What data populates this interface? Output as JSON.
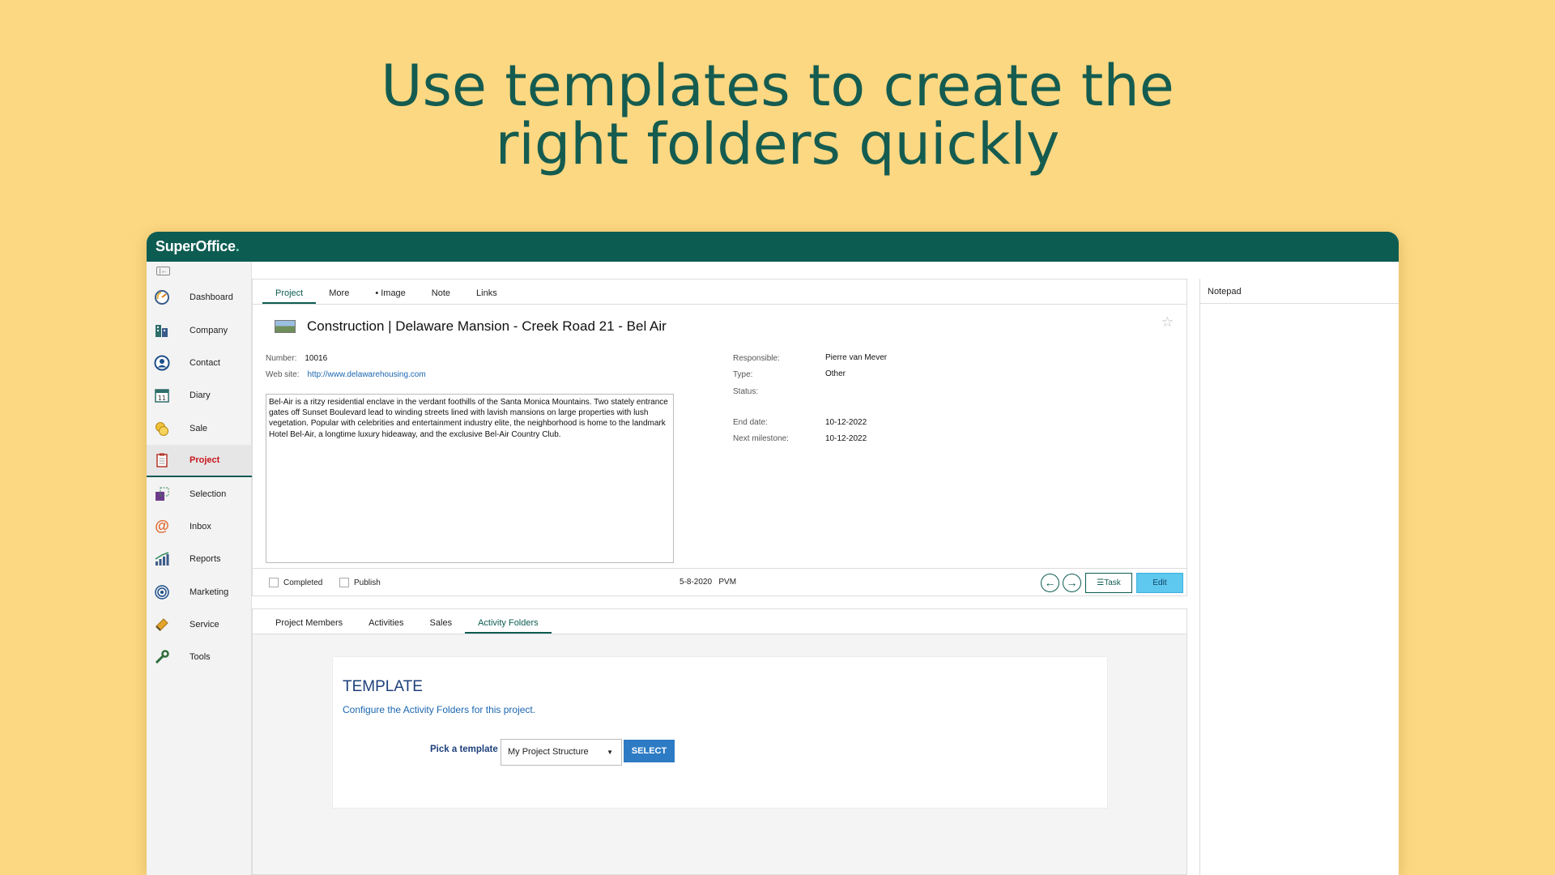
{
  "headline": {
    "line1": "Use templates to create the",
    "line2": "right folders quickly"
  },
  "app": {
    "logo": "SuperOffice",
    "logo_dot": "."
  },
  "sidebar": {
    "items": [
      {
        "label": "Dashboard",
        "icon": "dashboard-icon"
      },
      {
        "label": "Company",
        "icon": "company-icon"
      },
      {
        "label": "Contact",
        "icon": "contact-icon"
      },
      {
        "label": "Diary",
        "icon": "diary-icon",
        "icon_text": "11"
      },
      {
        "label": "Sale",
        "icon": "sale-icon"
      },
      {
        "label": "Project",
        "icon": "project-icon"
      },
      {
        "label": "Selection",
        "icon": "selection-icon"
      },
      {
        "label": "Inbox",
        "icon": "inbox-icon",
        "icon_text": "@"
      },
      {
        "label": "Reports",
        "icon": "reports-icon"
      },
      {
        "label": "Marketing",
        "icon": "marketing-icon"
      },
      {
        "label": "Service",
        "icon": "service-icon"
      },
      {
        "label": "Tools",
        "icon": "tools-icon"
      }
    ],
    "active": "Project"
  },
  "project": {
    "tabs": [
      "Project",
      "More",
      "• Image",
      "Note",
      "Links"
    ],
    "active_tab": "Project",
    "title": "Construction | Delaware Mansion - Creek Road 21 - Bel Air",
    "number_label": "Number:",
    "number": "10016",
    "website_label": "Web site:",
    "website": "http://www.delawarehousing.com",
    "description": "Bel-Air is a ritzy residential enclave in the verdant foothills of the Santa Monica Mountains. Two stately entrance gates off Sunset Boulevard lead to winding streets lined with lavish mansions on large properties with lush vegetation. Popular with celebrities and entertainment industry elite, the neighborhood is home to the landmark Hotel Bel-Air, a longtime luxury hideaway, and the exclusive Bel-Air Country Club.",
    "responsible_label": "Responsible:",
    "responsible": "Pierre van Mever",
    "type_label": "Type:",
    "type": "Other",
    "status_label": "Status:",
    "end_date_label": "End date:",
    "end_date": "10-12-2022",
    "next_milestone_label": "Next milestone:",
    "next_milestone": "10-12-2022"
  },
  "statusbar": {
    "completed_label": "Completed",
    "publish_label": "Publish",
    "date": "5-8-2020",
    "user": "PVM",
    "task_label": "☰Task",
    "edit_label": "Edit"
  },
  "subtabs": {
    "items": [
      "Project Members",
      "Activities",
      "Sales",
      "Activity Folders"
    ],
    "active": "Activity Folders"
  },
  "template_card": {
    "title": "TEMPLATE",
    "subtitle": "Configure the Activity Folders for this project.",
    "pick_label": "Pick a template",
    "selected": "My Project Structure",
    "select_button": "SELECT"
  },
  "notepad": {
    "title": "Notepad"
  },
  "colors": {
    "brand": "#0d5c52",
    "background": "#fdd882",
    "edit_button": "#5ec8ef",
    "select_button": "#2d7bc4",
    "active_nav_text": "#c8161d"
  }
}
